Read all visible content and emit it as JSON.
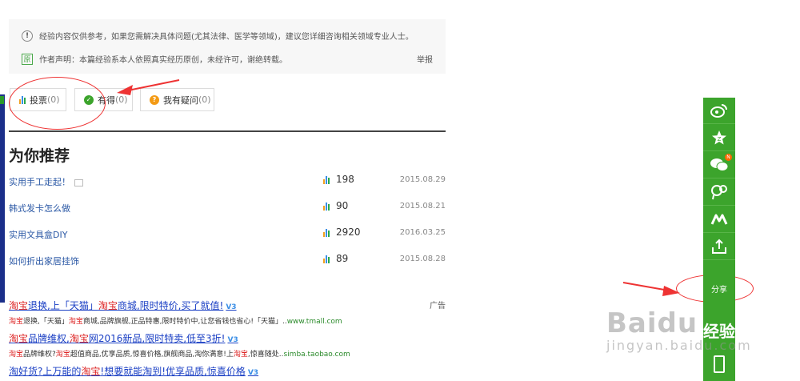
{
  "notice": {
    "disclaimer": "经验内容仅供参考，如果您需解决具体问题(尤其法律、医学等领域)，建议您详细咨询相关领域专业人士。",
    "statement": "作者声明：本篇经验系本人依照真实经历原创，未经许可，谢绝转载。",
    "report_label": "举报"
  },
  "actions": [
    {
      "label": "投票",
      "count": "(0)",
      "icon": "bar-chart-icon"
    },
    {
      "label": "有得",
      "count": "(0)",
      "icon": "check-circle-icon"
    },
    {
      "label": "我有疑问",
      "count": "(0)",
      "icon": "question-circle-icon"
    }
  ],
  "recommend": {
    "title": "为你推荐",
    "items": [
      {
        "title": "实用手工走起！",
        "has_image": true,
        "views": "198",
        "date": "2015.08.29"
      },
      {
        "title": "韩式发卡怎么做",
        "has_image": false,
        "views": "90",
        "date": "2015.08.21"
      },
      {
        "title": "实用文具盒DIY",
        "has_image": false,
        "views": "2920",
        "date": "2016.03.25"
      },
      {
        "title": "如何折出家居挂饰",
        "has_image": false,
        "views": "89",
        "date": "2015.08.28"
      }
    ]
  },
  "ads": {
    "label": "广告",
    "items": [
      {
        "title_parts": [
          {
            "t": "淘宝",
            "hl": true
          },
          {
            "t": "退换,上「天猫」",
            "hl": false
          },
          {
            "t": "淘宝",
            "hl": true
          },
          {
            "t": "商城,限时特价,买了就值!",
            "hl": false
          }
        ],
        "v": "V3",
        "desc_parts": [
          {
            "t": "淘宝",
            "hl": true
          },
          {
            "t": "退换,「天猫」",
            "hl": false
          },
          {
            "t": "淘宝",
            "hl": true
          },
          {
            "t": "商城,品牌旗舰,正品特惠,限时特价中,让您省钱也省心!「天猫」..",
            "hl": false
          }
        ],
        "url": "www.tmall.com"
      },
      {
        "title_parts": [
          {
            "t": "淘宝",
            "hl": true
          },
          {
            "t": "品牌维权,",
            "hl": false
          },
          {
            "t": "淘宝",
            "hl": true
          },
          {
            "t": "网2016新品,限时特卖,低至3折!",
            "hl": false
          }
        ],
        "v": "V3",
        "desc_parts": [
          {
            "t": "淘宝",
            "hl": true
          },
          {
            "t": "品牌维权?",
            "hl": false
          },
          {
            "t": "淘宝",
            "hl": true
          },
          {
            "t": "超值商品,优享品质,惊喜价格,旗舰商品,淘你满意!上",
            "hl": false
          },
          {
            "t": "淘宝",
            "hl": true
          },
          {
            "t": ",惊喜随处..",
            "hl": false
          }
        ],
        "url": "simba.taobao.com"
      },
      {
        "title_parts": [
          {
            "t": "淘好货?上万能的",
            "hl": false
          },
          {
            "t": "淘宝",
            "hl": true
          },
          {
            "t": "!想要就能淘到!优享品质,惊喜价格",
            "hl": false
          }
        ],
        "v": "V3",
        "desc_parts": [],
        "url": ""
      }
    ]
  },
  "sidebar": {
    "items": [
      {
        "name": "weibo-icon"
      },
      {
        "name": "qzone-star-icon"
      },
      {
        "name": "wechat-icon",
        "badge": "N"
      },
      {
        "name": "tieba-icon"
      },
      {
        "name": "renren-icon"
      },
      {
        "name": "upload-share-icon"
      }
    ],
    "share_label": "分享",
    "jingyan_label": "经验",
    "bottom_icon": "phone-icon"
  },
  "watermark": {
    "logo": "Baidu",
    "url": "jingyan.baidu.com"
  },
  "colors": {
    "accent_green": "#3ca42c",
    "link_blue": "#2b58a5",
    "highlight_red": "#dd2222",
    "annotation_red": "#ee3333"
  }
}
